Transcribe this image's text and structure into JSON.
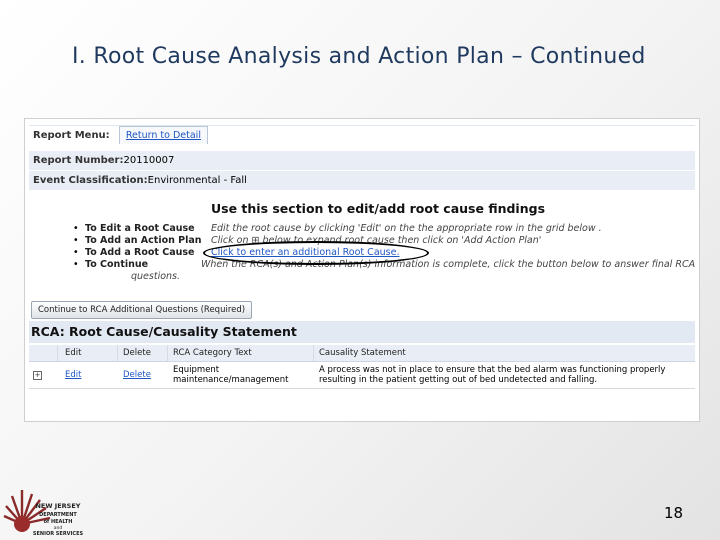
{
  "slide": {
    "title": "I.  Root Cause Analysis and Action Plan – Continued",
    "page_number": "18"
  },
  "report": {
    "menu_label": "Report Menu:",
    "menu_tab": "Return to Detail",
    "number_label": "Report Number:",
    "number_value": "20110007",
    "event_label": "Event Classification:",
    "event_value": "Environmental - Fall"
  },
  "section": {
    "heading": "Use this section to edit/add root cause findings"
  },
  "instructions": [
    {
      "label": "To Edit a Root Cause",
      "text": "Edit the root cause by clicking 'Edit' on the the appropriate row in the grid below ."
    },
    {
      "label": "To Add an Action Plan",
      "text": "Click on ⊞ below to expand root cause then click on 'Add Action Plan'"
    },
    {
      "label": "To Add a Root Cause",
      "link": "Click to enter an additional Root Cause."
    },
    {
      "label": "To Continue",
      "text": "When the RCA(s) and Action Plan(s) information is complete, click the button below to answer final RCA",
      "wrap": "questions."
    }
  ],
  "continue_button": "Continue to RCA Additional Questions (Required)",
  "grid": {
    "title": "RCA: Root Cause/Causality Statement",
    "columns": [
      "Edit",
      "Delete",
      "RCA Category Text",
      "Causality Statement"
    ],
    "rows": [
      {
        "expand": "+",
        "edit": "Edit",
        "delete": "Delete",
        "category_line1": "Equipment",
        "category_line2": "maintenance/management",
        "statement_line1": "A process was not in place to ensure that the bed alarm was functioning properly",
        "statement_line2": "resulting in the patient getting out of bed undetected and falling."
      }
    ]
  },
  "logo": {
    "line1": "NEW JERSEY",
    "line2": "DEPARTMENT",
    "line3": "of HEALTH",
    "line4": "and",
    "line5": "SENIOR SERVICES"
  }
}
